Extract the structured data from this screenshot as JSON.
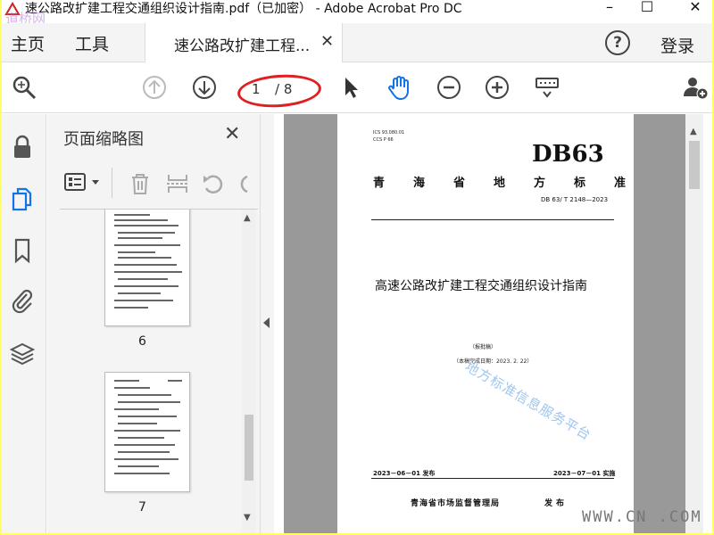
{
  "window": {
    "title": "速公路改扩建工程交通组织设计指南.pdf（已加密） - Adobe Acrobat Pro DC",
    "logo_text": "道桥网",
    "minimize": "–",
    "maximize": "☐",
    "close": "✕"
  },
  "nav": {
    "home": "主页",
    "tools": "工具",
    "tab_label": "速公路改扩建工程...",
    "tab_close": "✕",
    "help": "?",
    "login": "登录"
  },
  "toolbar": {
    "current_page": "1",
    "total_pages": "/ 8",
    "icons": [
      "search-zoom-icon",
      "prev-page-icon",
      "next-page-icon",
      "select-cursor-icon",
      "hand-tool-icon",
      "zoom-out-icon",
      "zoom-in-icon",
      "keyboard-tools-icon",
      "share-user-icon"
    ]
  },
  "sidebar": {
    "icons": [
      "lock-icon",
      "pages-icon",
      "bookmark-icon",
      "attachment-icon",
      "layers-icon"
    ]
  },
  "thumbnails": {
    "title": "页面缩略图",
    "close": "✕",
    "pages": [
      {
        "label": "6"
      },
      {
        "label": "7"
      }
    ]
  },
  "document": {
    "ics": "ICS 93.080.01",
    "ccs": "CCS P 66",
    "db": "DB63",
    "standard_label": "青海省地方标准",
    "code": "DB 63/ T 2148—2023",
    "title": "高速公路改扩建工程交通组织设计指南",
    "draft": "（报批稿）",
    "completed": "（本稿完成日期：2023. 2. 22）",
    "watermark": "地方标准信息服务平台",
    "issue_date": "2023－06－01 发布",
    "effective_date": "2023－07－01 实施",
    "publisher": "青海省市场监督管理局",
    "issue": "发布"
  },
  "site_watermark": "WWW.CN  .COM",
  "colors": {
    "accent_blue": "#1473e6",
    "highlight_red": "#e02020",
    "frame_yellow": "#ffff66"
  }
}
